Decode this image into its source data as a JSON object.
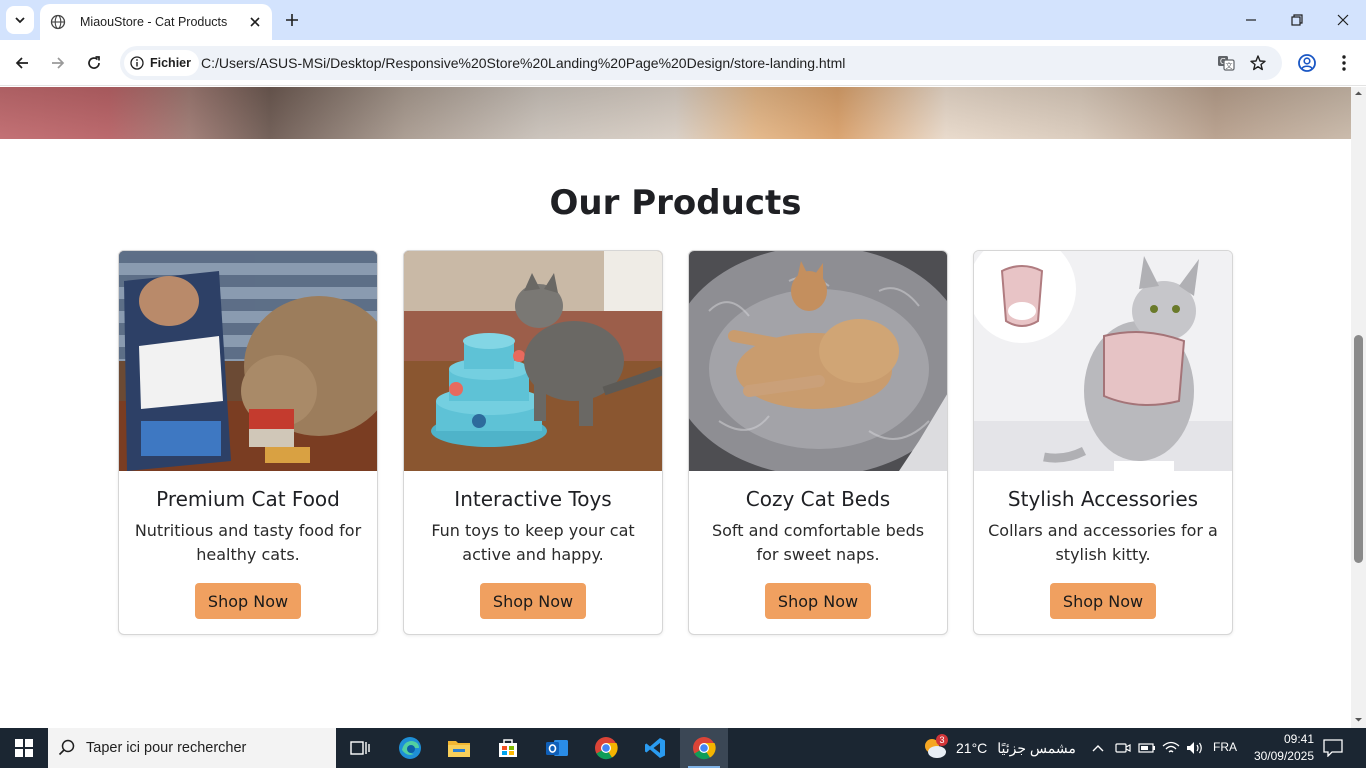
{
  "browser": {
    "tab_title": "MiaouStore - Cat Products",
    "security_chip": "Fichier",
    "url": "C:/Users/ASUS-MSi/Desktop/Responsive%20Store%20Landing%20Page%20Design/store-landing.html"
  },
  "page": {
    "section_title": "Our Products",
    "products": [
      {
        "name": "Premium Cat Food",
        "description": "Nutritious and tasty food for healthy cats.",
        "button": "Shop Now"
      },
      {
        "name": "Interactive Toys",
        "description": "Fun toys to keep your cat active and happy.",
        "button": "Shop Now"
      },
      {
        "name": "Cozy Cat Beds",
        "description": "Soft and comfortable beds for sweet naps.",
        "button": "Shop Now"
      },
      {
        "name": "Stylish Accessories",
        "description": "Collars and accessories for a stylish kitty.",
        "button": "Shop Now"
      }
    ],
    "button_color": "#f0a060"
  },
  "taskbar": {
    "search_placeholder": "Taper ici pour rechercher",
    "weather_badge": "3",
    "temperature": "21°C",
    "weather_condition": "مشمس جزئيًا",
    "language": "FRA",
    "time": "09:41",
    "date": "30/09/2025"
  }
}
